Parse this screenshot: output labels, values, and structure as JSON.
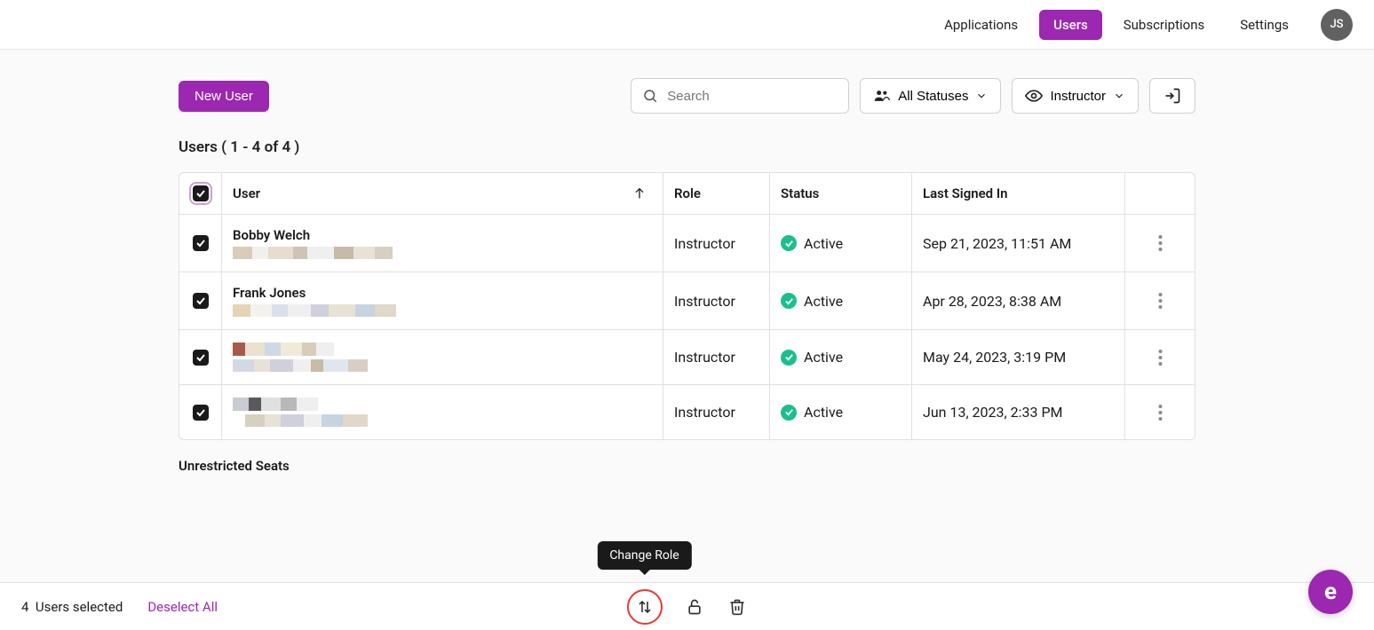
{
  "nav": {
    "items": [
      {
        "label": "Applications",
        "active": false
      },
      {
        "label": "Users",
        "active": true
      },
      {
        "label": "Subscriptions",
        "active": false
      },
      {
        "label": "Settings",
        "active": false
      }
    ],
    "avatar_initials": "JS"
  },
  "toolbar": {
    "new_user_label": "New User",
    "search_placeholder": "Search",
    "status_filter_label": "All Statuses",
    "role_filter_label": "Instructor"
  },
  "page_heading": "Users ( 1 - 4 of 4 )",
  "table": {
    "columns": {
      "user": "User",
      "role": "Role",
      "status": "Status",
      "last": "Last Signed In"
    },
    "rows": [
      {
        "name": "Bobby Welch",
        "redacted_name": false,
        "role": "Instructor",
        "status": "Active",
        "last": "Sep 21, 2023, 11:51 AM"
      },
      {
        "name": "Frank Jones",
        "redacted_name": false,
        "role": "Instructor",
        "status": "Active",
        "last": "Apr 28, 2023, 8:38 AM"
      },
      {
        "name": "",
        "redacted_name": true,
        "role": "Instructor",
        "status": "Active",
        "last": "May 24, 2023, 3:19 PM"
      },
      {
        "name": "",
        "redacted_name": true,
        "role": "Instructor",
        "status": "Active",
        "last": "Jun 13, 2023, 2:33 PM"
      }
    ]
  },
  "section_label": "Unrestricted Seats",
  "bottom": {
    "selected_count": "4",
    "selected_suffix": "Users selected",
    "deselect_label": "Deselect All",
    "tooltip": "Change Role"
  },
  "fab_glyph": "e"
}
